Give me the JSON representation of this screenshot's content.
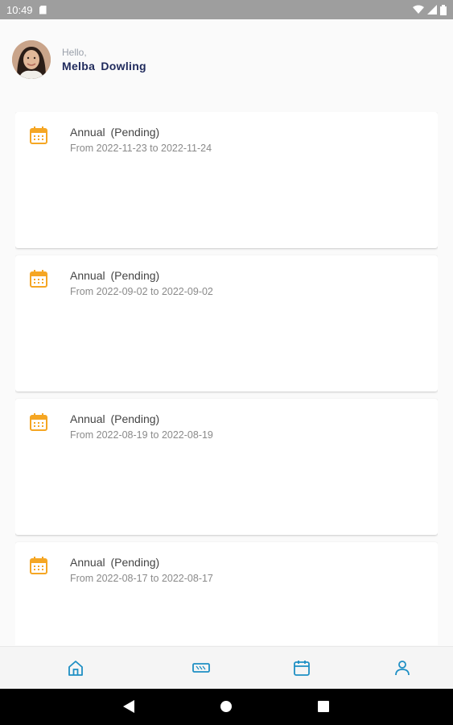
{
  "status_bar": {
    "time": "10:49"
  },
  "header": {
    "greeting": "Hello,",
    "user_name": "Melba  Dowling"
  },
  "leaves": [
    {
      "title": "Annual  (Pending)",
      "dates": "From 2022-11-23 to 2022-11-24"
    },
    {
      "title": "Annual  (Pending)",
      "dates": "From 2022-09-02 to 2022-09-02"
    },
    {
      "title": "Annual  (Pending)",
      "dates": "From 2022-08-19 to 2022-08-19"
    },
    {
      "title": "Annual  (Pending)",
      "dates": "From 2022-08-17 to 2022-08-17"
    }
  ],
  "bottom_nav": [
    "home-icon",
    "ticket-icon",
    "calendar-icon",
    "profile-icon"
  ],
  "colors": {
    "accent": "#1e8fc4",
    "calendar": "#f5a623",
    "name": "#1f2a5c"
  }
}
